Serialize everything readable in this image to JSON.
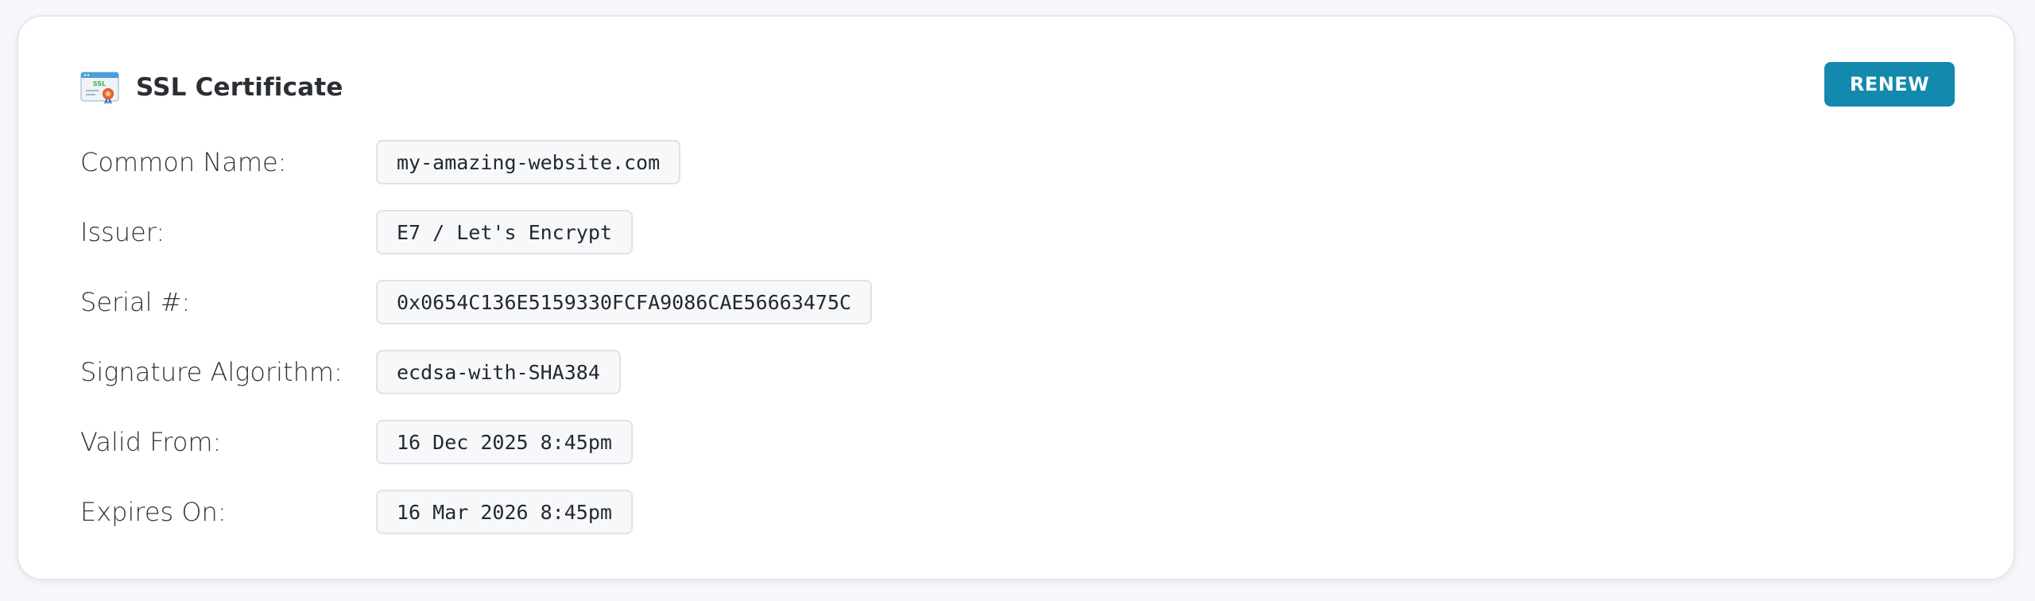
{
  "card": {
    "title": "SSL Certificate",
    "icon": "ssl-certificate-icon",
    "icon_text": "SSL",
    "renew_label": "RENEW"
  },
  "fields": [
    {
      "label": "Common Name:",
      "value": "my-amazing-website.com"
    },
    {
      "label": "Issuer:",
      "value": "E7 / Let's Encrypt"
    },
    {
      "label": "Serial #:",
      "value": "0x0654C136E5159330FCFA9086CAE56663475C"
    },
    {
      "label": "Signature Algorithm:",
      "value": "ecdsa-with-SHA384"
    },
    {
      "label": "Valid From:",
      "value": "16 Dec 2025 8:45pm"
    },
    {
      "label": "Expires On:",
      "value": "16 Mar 2026 8:45pm"
    }
  ],
  "colors": {
    "accent": "#1289ad",
    "page_background": "#f6f7fa",
    "card_background": "#ffffff",
    "value_background": "#f7f8fa"
  }
}
